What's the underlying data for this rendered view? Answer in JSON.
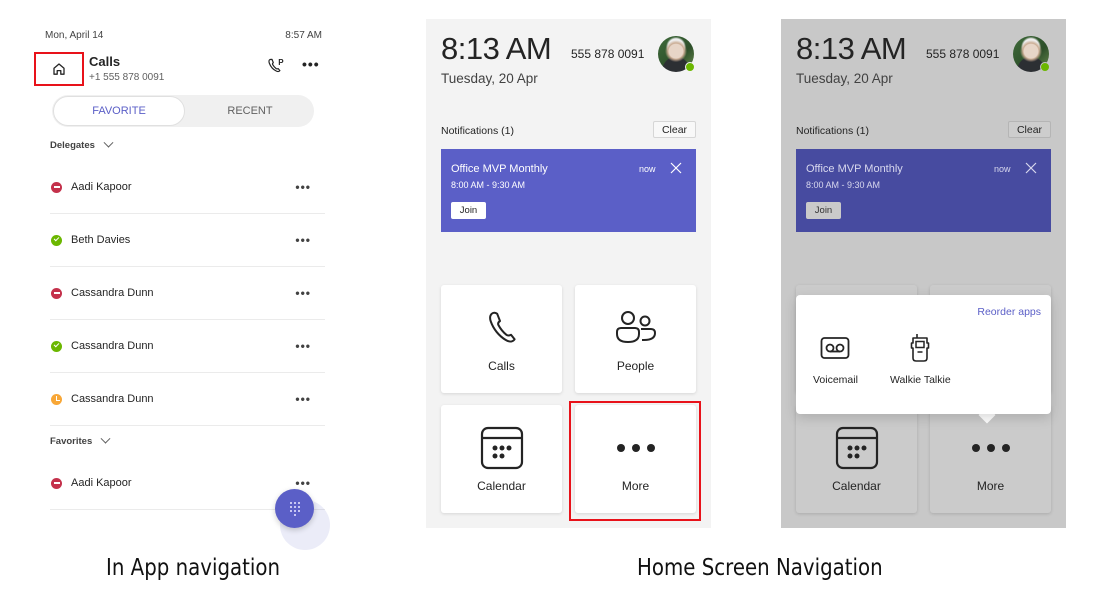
{
  "in_app": {
    "status_bar": {
      "date": "Mon, April 14",
      "time": "8:57 AM"
    },
    "header": {
      "home_icon": "home-icon",
      "title": "Calls",
      "subtitle": "+1 555 878 0091",
      "park_icon": "call-park-icon",
      "more_label": "•••"
    },
    "tabs": [
      {
        "label": "FAVORITE",
        "selected": true
      },
      {
        "label": "RECENT",
        "selected": false
      }
    ],
    "sections": [
      {
        "title": "Delegates",
        "items": [
          {
            "name": "Aadi Kapoor",
            "presence": "do-not-disturb",
            "more": "•••"
          },
          {
            "name": "Beth Davies",
            "presence": "available",
            "more": "•••"
          },
          {
            "name": "Cassandra Dunn",
            "presence": "do-not-disturb",
            "more": "•••"
          },
          {
            "name": "Cassandra Dunn",
            "presence": "available",
            "more": "•••"
          },
          {
            "name": "Cassandra Dunn",
            "presence": "away",
            "more": "•••"
          }
        ]
      },
      {
        "title": "Favorites",
        "items": [
          {
            "name": "Aadi Kapoor",
            "presence": "do-not-disturb",
            "more": "•••"
          }
        ]
      }
    ],
    "fab_icon": "dialpad-icon"
  },
  "home_screen": {
    "time": "8:13 AM",
    "phone_number": "555 878 0091",
    "date": "Tuesday, 20 Apr",
    "avatar_status": "available",
    "notifications_label": "Notifications (1)",
    "clear_label": "Clear",
    "notification": {
      "title": "Office MVP Monthly",
      "time_range": "8:00 AM - 9:30 AM",
      "age": "now",
      "join_label": "Join"
    },
    "tiles": [
      {
        "label": "Calls",
        "icon": "phone-icon"
      },
      {
        "label": "People",
        "icon": "people-icon"
      },
      {
        "label": "Calendar",
        "icon": "calendar-icon"
      },
      {
        "label": "More",
        "icon": "more-icon"
      }
    ]
  },
  "home_popover": {
    "reorder_label": "Reorder apps",
    "items": [
      {
        "label": "Voicemail",
        "icon": "voicemail-icon"
      },
      {
        "label": "Walkie Talkie",
        "icon": "walkie-talkie-icon"
      }
    ]
  },
  "colors": {
    "accent": "#5b5fc7",
    "highlight": "#e8121a",
    "presence_available": "#6bb700",
    "presence_dnd": "#c4314b",
    "presence_away": "#f8a737"
  },
  "captions": {
    "left": "In App navigation",
    "right": "Home Screen Navigation"
  }
}
